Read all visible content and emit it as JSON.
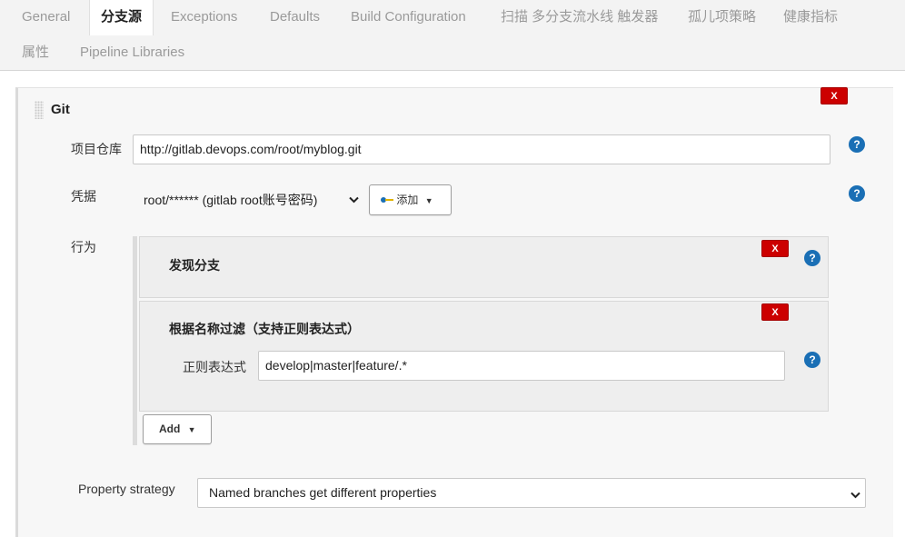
{
  "tabs": [
    {
      "label": "General",
      "active": false
    },
    {
      "label": "分支源",
      "active": true
    },
    {
      "label": "Exceptions",
      "active": false
    },
    {
      "label": "Defaults",
      "active": false
    },
    {
      "label": "Build Configuration",
      "active": false
    },
    {
      "label": "扫描 多分支流水线 触发器",
      "active": false
    },
    {
      "label": "孤儿项策略",
      "active": false
    },
    {
      "label": "健康指标",
      "active": false
    },
    {
      "label": "属性",
      "active": false
    },
    {
      "label": "Pipeline Libraries",
      "active": false
    }
  ],
  "git_section": {
    "title": "Git",
    "delete_label": "X",
    "repo": {
      "label": "项目仓库",
      "value": "http://gitlab.devops.com/root/myblog.git"
    },
    "credentials": {
      "label": "凭据",
      "selected": "root/****** (gitlab root账号密码)",
      "add_label": "添加"
    },
    "behaviors": {
      "label": "行为",
      "items": [
        {
          "title": "发现分支",
          "delete_label": "X"
        },
        {
          "title": "根据名称过滤（支持正则表达式）",
          "delete_label": "X",
          "field_label": "正则表达式",
          "field_value": "develop|master|feature/.*"
        }
      ],
      "add_label": "Add"
    },
    "help_label": "?"
  },
  "property_strategy": {
    "label": "Property strategy",
    "selected": "Named branches get different properties"
  },
  "colors": {
    "delete": "#cc0000",
    "help": "#1a6fb5",
    "tab_bg": "#f3f3f3",
    "panel_bg": "#f7f7f7"
  },
  "icons": {
    "drag": "drag-handle-icon",
    "help": "help-icon",
    "credentials": "key-icon",
    "dropdown": "chevron-down-icon"
  }
}
